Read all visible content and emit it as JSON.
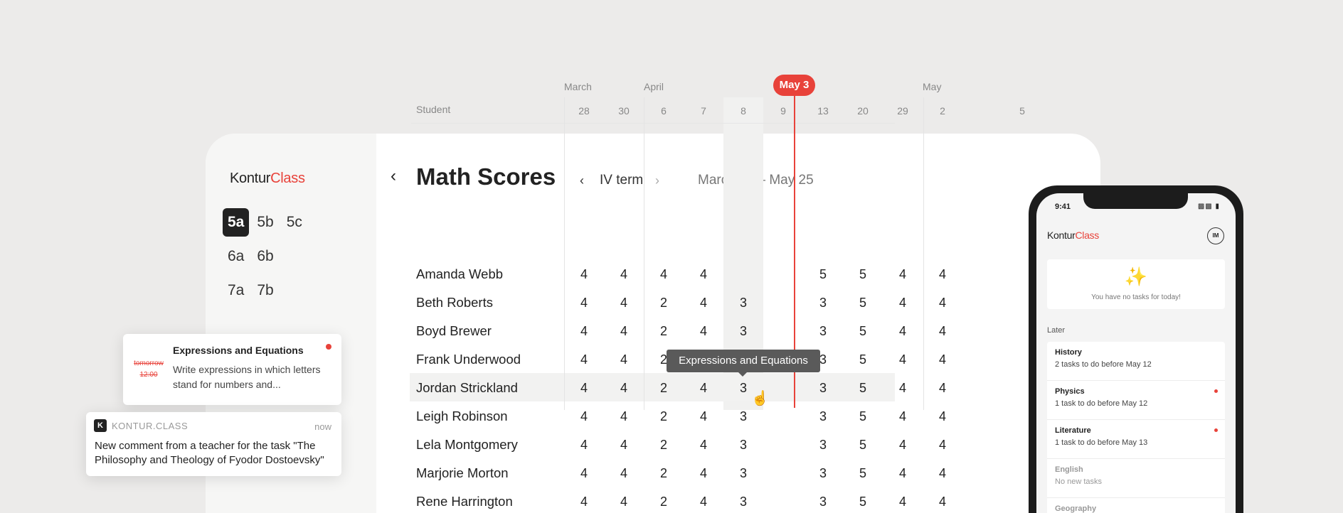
{
  "logo": {
    "part1": "Kontur",
    "part2": "Class"
  },
  "classes": [
    [
      "5a",
      "5b",
      "5c"
    ],
    [
      "6a",
      "6b"
    ],
    [
      "7a",
      "7b"
    ]
  ],
  "header": {
    "back_icon": "chevron-left-icon",
    "title": "Math Scores",
    "term": "IV term",
    "date_range": "March 28 – May 25"
  },
  "grid": {
    "months": [
      "March",
      "April",
      "May"
    ],
    "student_header": "Student",
    "dates": [
      "28",
      "30",
      "6",
      "7",
      "8",
      "9",
      "13",
      "20",
      "29",
      "2",
      "5"
    ],
    "today": "May 3",
    "tooltip": "Expressions and Equations",
    "students": [
      {
        "name": "Amanda Webb",
        "scores": [
          "4",
          "4",
          "4",
          "4",
          "",
          "",
          "5",
          "5",
          "4",
          "4"
        ]
      },
      {
        "name": "Beth Roberts",
        "scores": [
          "4",
          "4",
          "2",
          "4",
          "3",
          "",
          "3",
          "5",
          "4",
          "4"
        ]
      },
      {
        "name": "Boyd Brewer",
        "scores": [
          "4",
          "4",
          "2",
          "4",
          "3",
          "",
          "3",
          "5",
          "4",
          "4"
        ]
      },
      {
        "name": "Frank Underwood",
        "scores": [
          "4",
          "4",
          "2",
          "4",
          "3",
          "",
          "3",
          "5",
          "4",
          "4"
        ]
      },
      {
        "name": "Jordan Strickland",
        "scores": [
          "4",
          "4",
          "2",
          "4",
          "3",
          "",
          "3",
          "5",
          "4",
          "4"
        ]
      },
      {
        "name": "Leigh Robinson",
        "scores": [
          "4",
          "4",
          "2",
          "4",
          "3",
          "",
          "3",
          "5",
          "4",
          "4"
        ]
      },
      {
        "name": "Lela Montgomery",
        "scores": [
          "4",
          "4",
          "2",
          "4",
          "3",
          "",
          "3",
          "5",
          "4",
          "4"
        ]
      },
      {
        "name": "Marjorie Morton",
        "scores": [
          "4",
          "4",
          "2",
          "4",
          "3",
          "",
          "3",
          "5",
          "4",
          "4"
        ]
      },
      {
        "name": "Rene Harrington",
        "scores": [
          "4",
          "4",
          "2",
          "4",
          "3",
          "",
          "3",
          "5",
          "4",
          "4"
        ]
      }
    ]
  },
  "notification1": {
    "when": "tomorrow",
    "time": "12:00",
    "title": "Expressions and Equations",
    "body": "Write expressions in which letters stand for numbers and..."
  },
  "notification2": {
    "app": "KONTUR.CLASS",
    "app_icon": "K",
    "time": "now",
    "body": "New comment from a teacher for the task \"The Philosophy and Theology of Fyodor Dostoevsky\""
  },
  "phone": {
    "status_time": "9:41",
    "logo1": "Kontur",
    "logo2": "Class",
    "avatar": "IM",
    "empty_icon": "sparkles-icon",
    "empty_text": "You have no tasks for today!",
    "later_label": "Later",
    "items": [
      {
        "subject": "History",
        "desc": "2 tasks to do before May 12",
        "dot": false,
        "muted": false
      },
      {
        "subject": "Physics",
        "desc": "1 task to do before May 12",
        "dot": true,
        "muted": false
      },
      {
        "subject": "Literature",
        "desc": "1 task to do before May 13",
        "dot": true,
        "muted": false
      },
      {
        "subject": "English",
        "desc": "No new tasks",
        "dot": false,
        "muted": true
      },
      {
        "subject": "Geography",
        "desc": "",
        "dot": false,
        "muted": true
      }
    ]
  },
  "colors": {
    "accent": "#e8423a",
    "background": "#ecebea",
    "text": "#222222"
  }
}
